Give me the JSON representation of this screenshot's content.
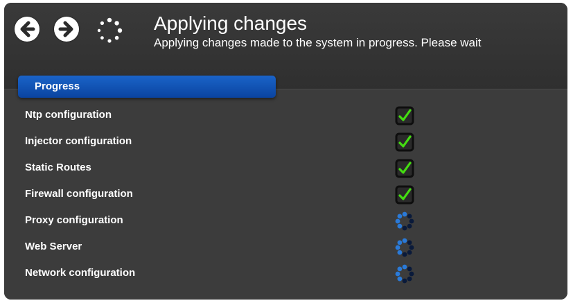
{
  "header": {
    "title": "Applying changes",
    "subtitle": "Applying changes made to the system in progress. Please wait"
  },
  "icons": {
    "back": "arrow-left-circle",
    "forward": "arrow-right-circle",
    "busy": "busy-spinner"
  },
  "tab": {
    "label": "Progress"
  },
  "colors": {
    "accent": "#1159c0",
    "check": "#44dd11",
    "spinner_blue": "#2a7ad8",
    "spinner_dark": "#0a1a3a"
  },
  "items": [
    {
      "label": "Ntp configuration",
      "status": "done"
    },
    {
      "label": "Injector configuration",
      "status": "done"
    },
    {
      "label": "Static Routes",
      "status": "done"
    },
    {
      "label": "Firewall configuration",
      "status": "done"
    },
    {
      "label": "Proxy configuration",
      "status": "in-progress"
    },
    {
      "label": "Web Server",
      "status": "in-progress"
    },
    {
      "label": "Network configuration",
      "status": "in-progress"
    }
  ]
}
